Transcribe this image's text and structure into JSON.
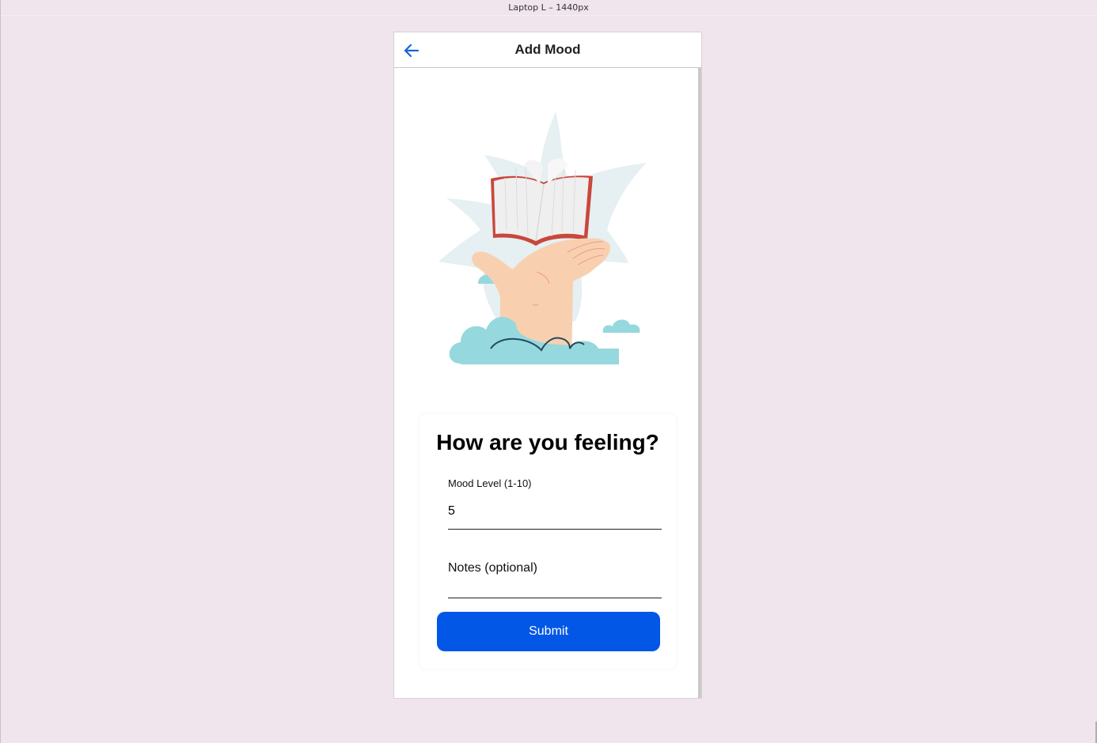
{
  "canvas": {
    "frame_label": "Laptop L – 1440px"
  },
  "app_bar": {
    "title": "Add Mood",
    "back_icon": "arrow-left-icon"
  },
  "illustration": {
    "name": "hand-holding-book-illustration"
  },
  "form": {
    "heading": "How are you feeling?",
    "mood_level": {
      "label": "Mood Level (1-10)",
      "value": "5"
    },
    "notes": {
      "placeholder": "Notes (optional)",
      "value": ""
    },
    "submit_label": "Submit"
  },
  "colors": {
    "background": "#f0e4ed",
    "accent": "#0257e6",
    "illustration_cloud": "#95d8de",
    "illustration_skin": "#f8d0b0",
    "illustration_book_cover": "#c9473b"
  }
}
